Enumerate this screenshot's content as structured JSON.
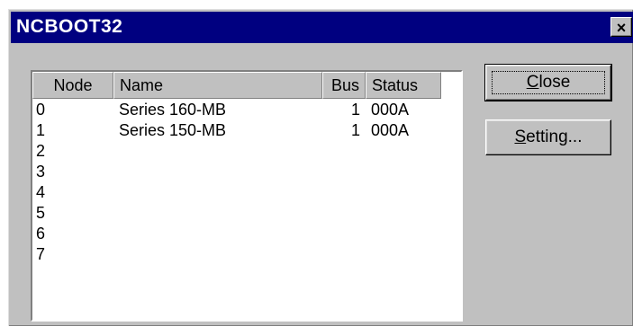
{
  "window": {
    "title": "NCBOOT32",
    "close_glyph": "×"
  },
  "list": {
    "columns": [
      "Node",
      "Name",
      "Bus",
      "Status"
    ],
    "rows": [
      {
        "node": "0",
        "name": "Series 160-MB",
        "bus": "1",
        "status": "000A"
      },
      {
        "node": "1",
        "name": "Series 150-MB",
        "bus": "1",
        "status": "000A"
      },
      {
        "node": "2",
        "name": "",
        "bus": "",
        "status": ""
      },
      {
        "node": "3",
        "name": "",
        "bus": "",
        "status": ""
      },
      {
        "node": "4",
        "name": "",
        "bus": "",
        "status": ""
      },
      {
        "node": "5",
        "name": "",
        "bus": "",
        "status": ""
      },
      {
        "node": "6",
        "name": "",
        "bus": "",
        "status": ""
      },
      {
        "node": "7",
        "name": "",
        "bus": "",
        "status": ""
      }
    ]
  },
  "buttons": {
    "close": {
      "mnemonic": "C",
      "rest": "lose"
    },
    "setting": {
      "mnemonic": "S",
      "rest": "etting..."
    }
  },
  "colors": {
    "titlebar": "#000080",
    "face": "#c0c0c0"
  }
}
